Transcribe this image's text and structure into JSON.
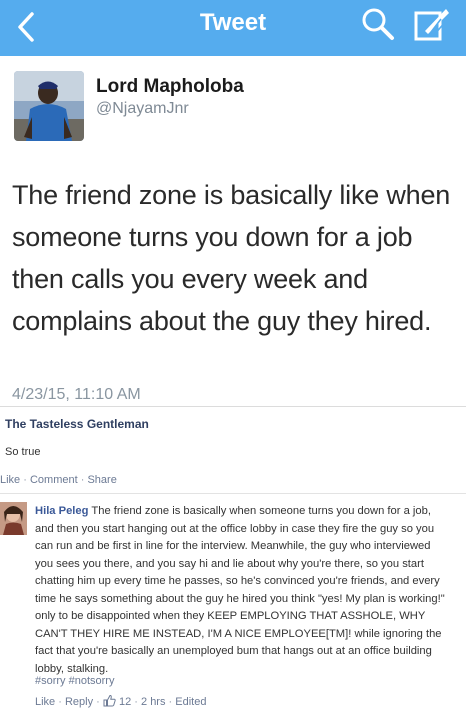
{
  "nav": {
    "title": "Tweet",
    "back_icon": "chevron-left-icon",
    "search_icon": "search-icon",
    "compose_icon": "compose-icon",
    "background": "#55acee"
  },
  "tweet": {
    "display_name": "Lord Mapholoba",
    "handle": "@NjayamJnr",
    "text": "The friend zone is basically like when someone turns you down for a job then calls you every week and complains about the guy they hired.",
    "timestamp": "4/23/15, 11:10 AM"
  },
  "post": {
    "author": "The Tasteless Gentleman",
    "text": "So true",
    "actions": [
      "Like",
      "Comment",
      "Share"
    ]
  },
  "comment": {
    "author": "Hila Peleg",
    "text": "The friend zone is basically when someone turns you down for a job, and then you start hanging out at the office lobby in case they fire the guy so you can run and be first in line for the interview. Meanwhile, the guy who interviewed you sees you there, and you say hi and lie about why you're there, so you start chatting him up every time he passes, so he's convinced you're friends, and every time he says something about the guy he hired you think \"yes! My plan is working!\" only to be disappointed when they KEEP EMPLOYING THAT ASSHOLE, WHY CAN'T THEY HIRE ME INSTEAD, I'M A NICE EMPLOYEE[TM]! while ignoring the fact that you're basically an unemployed bum that hangs out at an office building lobby, stalking.",
    "tags": "#sorry #notsorry",
    "like_label": "Like",
    "reply_label": "Reply",
    "like_count": "12",
    "time": "2 hrs",
    "edited": "Edited"
  }
}
